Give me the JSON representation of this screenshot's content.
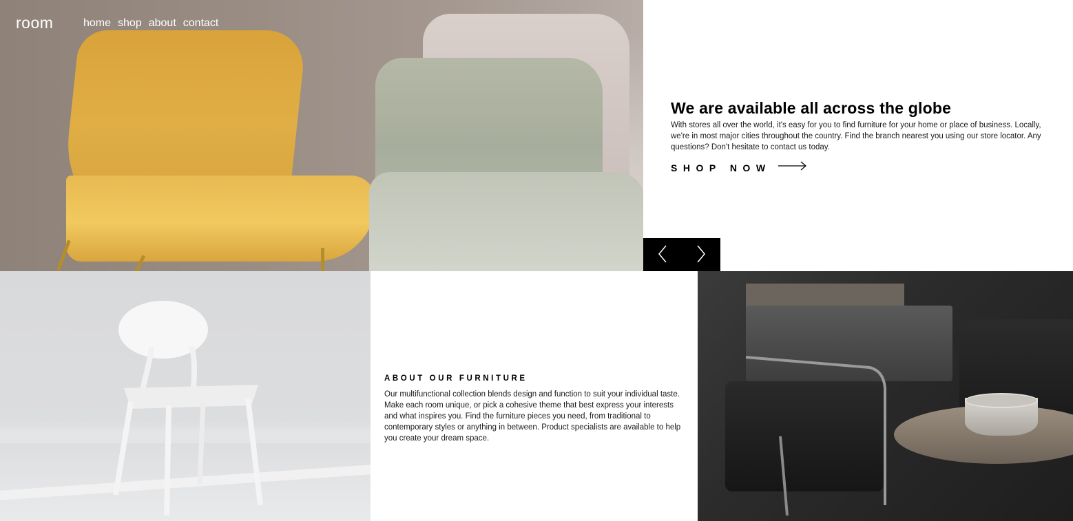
{
  "header": {
    "logo": "room",
    "nav": [
      "home",
      "shop",
      "about",
      "contact"
    ]
  },
  "hero": {
    "title": "We are available all across the globe",
    "description": "With stores all over the world, it's easy for you to find furniture for your home or place of business. Locally, we're in most major cities throughout the country. Find the branch nearest you using our store locator. Any questions? Don't hesitate to contact us today.",
    "cta_label": "SHOP NOW",
    "cta_icon": "arrow-right-icon"
  },
  "slider": {
    "prev_icon": "chevron-left-icon",
    "next_icon": "chevron-right-icon"
  },
  "about": {
    "title": "ABOUT OUR FURNITURE",
    "description": "Our multifunctional collection blends design and function to suit your individual taste. Make each room unique, or pick a cohesive theme that best express your interests and what inspires you. Find the furniture pieces you need, from traditional to contemporary styles or anything in between. Product specialists are available to help you create your dream space."
  },
  "colors": {
    "controls_bg": "#000000",
    "text": "#000000",
    "nav_text": "#ffffff"
  }
}
